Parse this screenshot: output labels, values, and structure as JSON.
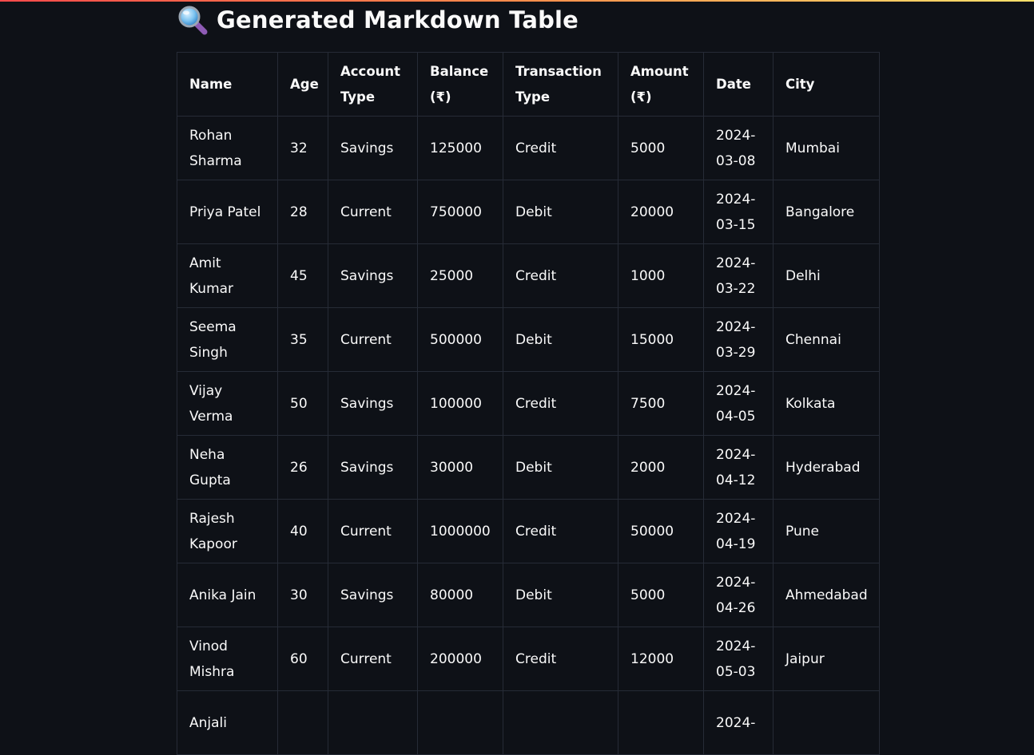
{
  "header": {
    "title": "Generated Markdown Table",
    "icon": "magnifying-glass-icon"
  },
  "colors": {
    "background": "#0e1117",
    "border": "#262b36",
    "text": "#fafafa",
    "top_bar_gradient": [
      "#ff4b4b",
      "#ffe16b"
    ]
  },
  "table": {
    "columns": [
      "Name",
      "Age",
      "Account Type",
      "Balance (₹)",
      "Transaction Type",
      "Amount (₹)",
      "Date",
      "City"
    ],
    "rows": [
      [
        "Rohan Sharma",
        "32",
        "Savings",
        "125000",
        "Credit",
        "5000",
        "2024-03-08",
        "Mumbai"
      ],
      [
        "Priya Patel",
        "28",
        "Current",
        "750000",
        "Debit",
        "20000",
        "2024-03-15",
        "Bangalore"
      ],
      [
        "Amit Kumar",
        "45",
        "Savings",
        "25000",
        "Credit",
        "1000",
        "2024-03-22",
        "Delhi"
      ],
      [
        "Seema Singh",
        "35",
        "Current",
        "500000",
        "Debit",
        "15000",
        "2024-03-29",
        "Chennai"
      ],
      [
        "Vijay Verma",
        "50",
        "Savings",
        "100000",
        "Credit",
        "7500",
        "2024-04-05",
        "Kolkata"
      ],
      [
        "Neha Gupta",
        "26",
        "Savings",
        "30000",
        "Debit",
        "2000",
        "2024-04-12",
        "Hyderabad"
      ],
      [
        "Rajesh Kapoor",
        "40",
        "Current",
        "1000000",
        "Credit",
        "50000",
        "2024-04-19",
        "Pune"
      ],
      [
        "Anika Jain",
        "30",
        "Savings",
        "80000",
        "Debit",
        "5000",
        "2024-04-26",
        "Ahmedabad"
      ],
      [
        "Vinod Mishra",
        "60",
        "Current",
        "200000",
        "Credit",
        "12000",
        "2024-05-03",
        "Jaipur"
      ],
      [
        "Anjali",
        "",
        "",
        "",
        "",
        "",
        "2024-",
        ""
      ]
    ]
  }
}
